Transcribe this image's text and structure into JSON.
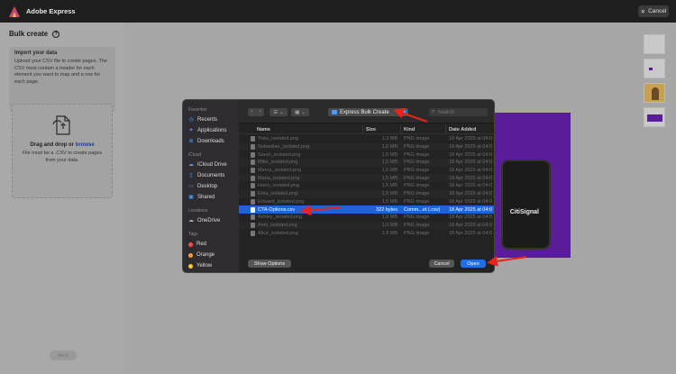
{
  "app": {
    "title": "Adobe Express",
    "cancel_label": "Cancel"
  },
  "bulk": {
    "title": "Bulk create",
    "import_title": "Import your data",
    "import_text": "Upload your CSV file to create pages. The CSV must contain a header for each element you want to map and a row for each page.",
    "drop_main": "Drag and drop or ",
    "drop_link": "browse",
    "drop_sub": "File must be a .CSV to create pages from your data.",
    "next_label": "Next"
  },
  "canvas": {
    "brand": "CitiSignal"
  },
  "dialog": {
    "sidebar": {
      "favorites_label": "Favorites",
      "favorites": [
        "Recents",
        "Applications",
        "Downloads"
      ],
      "icloud_label": "iCloud",
      "icloud": [
        "iCloud Drive",
        "Documents",
        "Desktop",
        "Shared"
      ],
      "locations_label": "Locations",
      "locations": [
        "OneDrive"
      ],
      "tags_label": "Tags",
      "tags": [
        {
          "label": "Red",
          "color": "#ff4d4d"
        },
        {
          "label": "Orange",
          "color": "#ff9f2e"
        },
        {
          "label": "Yellow",
          "color": "#f5d020"
        }
      ]
    },
    "location": "Express Bulk Create",
    "search_placeholder": "Search",
    "columns": {
      "name": "Name",
      "size": "Size",
      "kind": "Kind",
      "date": "Date Added"
    },
    "files": [
      {
        "name": "Yuko_isolated.png",
        "size": "1,3 MB",
        "kind": "PNG image",
        "date": "18 Apr 2025 at 04:0"
      },
      {
        "name": "Sebastian_isolated.png",
        "size": "1,6 MB",
        "kind": "PNG image",
        "date": "18 Apr 2025 at 04:0"
      },
      {
        "name": "Sarah_isolated.png",
        "size": "1,5 MB",
        "kind": "PNG image",
        "date": "18 Apr 2025 at 04:0"
      },
      {
        "name": "Mike_isolated.png",
        "size": "1,5 MB",
        "kind": "PNG image",
        "date": "18 Apr 2025 at 04:0"
      },
      {
        "name": "Meera_isolated.png",
        "size": "1,6 MB",
        "kind": "PNG image",
        "date": "18 Apr 2025 at 04:0"
      },
      {
        "name": "Maria_isolated.png",
        "size": "1,5 MB",
        "kind": "PNG image",
        "date": "18 Apr 2025 at 04:0"
      },
      {
        "name": "Harry_isolated.png",
        "size": "1,5 MB",
        "kind": "PNG image",
        "date": "18 Apr 2025 at 04:0"
      },
      {
        "name": "Ema_isolated.png",
        "size": "1,5 MB",
        "kind": "PNG image",
        "date": "18 Apr 2025 at 04:0"
      },
      {
        "name": "Edward_isolated.png",
        "size": "1,5 MB",
        "kind": "PNG image",
        "date": "18 Apr 2025 at 04:0"
      },
      {
        "name": "CTA-Options.csv",
        "size": "322 bytes",
        "kind": "Comm...et (.csv)",
        "date": "18 Apr 2025 at 04:0",
        "selected": true
      },
      {
        "name": "Ashley_isolated.png",
        "size": "1,8 MB",
        "kind": "PNG image",
        "date": "18 Apr 2025 at 04:0"
      },
      {
        "name": "Amit_isolated.png",
        "size": "1,5 MB",
        "kind": "PNG image",
        "date": "18 Apr 2025 at 04:0"
      },
      {
        "name": "Alice_isolated.png",
        "size": "1,8 MB",
        "kind": "PNG image",
        "date": "18 Apr 2025 at 04:0"
      }
    ],
    "show_options": "Show Options",
    "cancel": "Cancel",
    "open": "Open"
  },
  "colors": {
    "accent": "#1f6fe5",
    "annotation": "#e8231b",
    "brand_purple": "#5a1d9a"
  }
}
